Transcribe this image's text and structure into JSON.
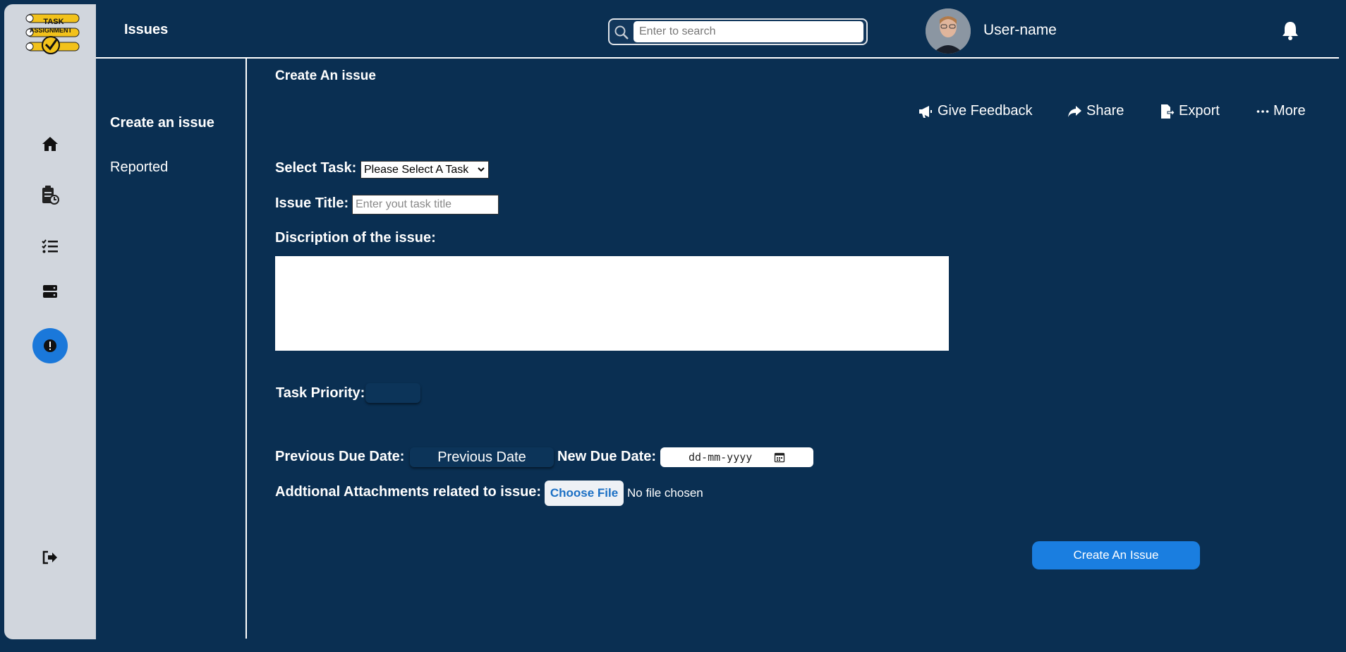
{
  "app": {
    "logo_text": [
      "TASK",
      "ASSIGNMENT"
    ],
    "section_title": "Issues"
  },
  "search": {
    "placeholder": "Enter to search"
  },
  "user": {
    "name": "User-name"
  },
  "rail": {
    "icons": [
      "home-icon",
      "clipboard-icon",
      "task-list-icon",
      "server-icon",
      "issue-icon",
      "logout-icon"
    ],
    "active": "issue-icon",
    "active_color": "#1a78da"
  },
  "subnav": {
    "items": [
      {
        "label": "Create an issue",
        "active": true
      },
      {
        "label": "Reported",
        "active": false
      }
    ]
  },
  "page": {
    "title": "Create An issue"
  },
  "toolbar": {
    "feedback": "Give Feedback",
    "share": "Share",
    "export": "Export",
    "more": "More"
  },
  "form": {
    "select_task_label": "Select Task:",
    "select_task_value": "Please Select A Task",
    "issue_title_label": "Issue Title:",
    "issue_title_placeholder": "Enter yout task title",
    "description_label": "Discription of the issue:",
    "priority_label": "Task Priority:",
    "prev_due_label": "Previous Due Date:",
    "prev_date_value": "Previous Date",
    "new_due_label": "New Due Date:",
    "new_date_placeholder": "dd-mm-yyyy",
    "attachments_label": "Addtional Attachments related to issue:",
    "choose_file": "Choose File",
    "no_file": "No file chosen",
    "submit": "Create An Issue"
  },
  "colors": {
    "background": "#0a2f52",
    "rail": "#d1d6dd",
    "accent": "#1a7ee0"
  }
}
